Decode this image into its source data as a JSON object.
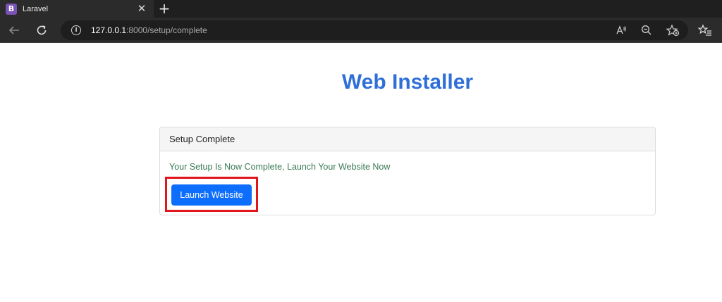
{
  "browser": {
    "tab_title": "Laravel",
    "tab_favicon_letter": "B",
    "tab_close": "✕",
    "new_tab": "+",
    "url_host": "127.0.0.1",
    "url_rest": ":8000/setup/complete"
  },
  "page": {
    "title": "Web Installer",
    "card_header": "Setup Complete",
    "success_message": "Your Setup Is Now Complete, Launch Your Website Now",
    "launch_button": "Launch Website"
  },
  "colors": {
    "title": "#2f6fd8",
    "success_text": "#3a7a55",
    "primary_button": "#0d6efd",
    "highlight_box": "#e2141c"
  },
  "icons": {
    "back": "back-arrow-icon",
    "reload": "reload-icon",
    "info": "info-icon",
    "read_aloud": "read-aloud-icon",
    "zoom": "zoom-out-icon",
    "add_favorite": "add-favorite-icon",
    "favorites": "favorites-icon"
  }
}
